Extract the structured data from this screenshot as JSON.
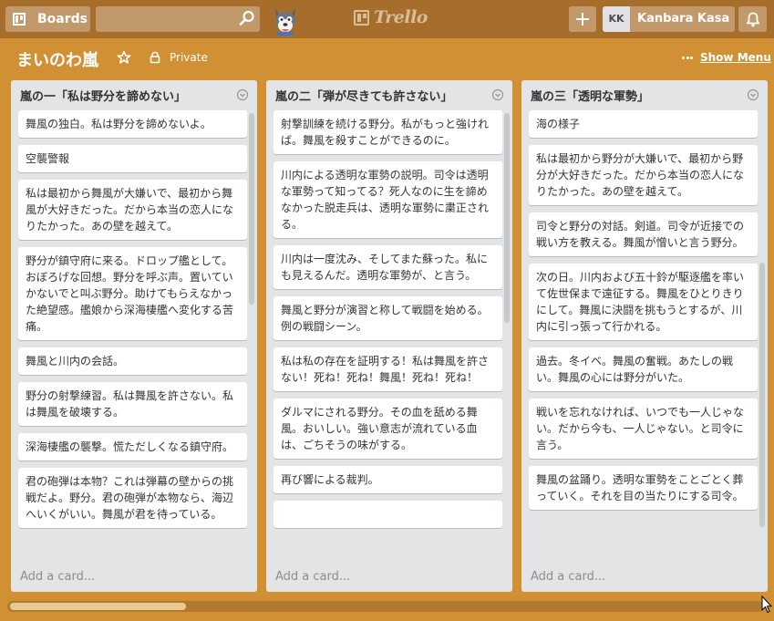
{
  "header": {
    "boards_label": "Boards",
    "search": {
      "value": "",
      "placeholder": ""
    },
    "logo_text": "Trello",
    "user": {
      "initials": "KK",
      "name": "Kanbara Kasa"
    }
  },
  "board": {
    "title": "まいのわ嵐",
    "visibility": "Private",
    "show_menu": "Show Menu"
  },
  "lists": [
    {
      "title": "嵐の一「私は野分を諦めない」",
      "cards": [
        "舞風の独白。私は野分を諦めないよ。",
        "空襲警報",
        "私は最初から舞風が大嫌いで、最初から舞風が大好きだった。だから本当の恋人になりたかった。あの壁を越えて。",
        "野分が鎮守府に来る。ドロップ艦として。おぼろげな回想。野分を呼ぶ声。置いていかないでと叫ぶ野分。助けてもらえなかった絶望感。艦娘から深海棲艦へ変化する苦痛。",
        "舞風と川内の会話。",
        "野分の射撃練習。私は舞風を許さない。私は舞風を破壊する。",
        "深海棲艦の襲撃。慌ただしくなる鎮守府。",
        "君の砲弾は本物？これは弾幕の壁からの挑戦だよ。野分。君の砲弾が本物なら、海辺へいくがいい。舞風が君を待っている。"
      ],
      "add_card": "Add a card..."
    },
    {
      "title": "嵐の二「弾が尽きても許さない」",
      "cards": [
        "射撃訓練を続ける野分。私がもっと強ければ。舞風を殺すことができるのに。",
        "川内による透明な軍勢の説明。司令は透明な軍勢って知ってる？死人なのに生を諦めなかった脱走兵は、透明な軍勢に粛正される。",
        "川内は一度沈み、そしてまた蘇った。私にも見えるんだ。透明な軍勢が、と言う。",
        "舞風と野分が演習と称して戦闘を始める。例の戦闘シーン。",
        "私は私の存在を証明する！私は舞風を許さない！死ね！死ね！舞風！死ね！死ね！",
        "ダルマにされる野分。その血を舐める舞風。おいしい。強い意志が流れている血は、ごちそうの味がする。",
        "再び響による裁判。",
        ""
      ],
      "add_card": "Add a card..."
    },
    {
      "title": "嵐の三「透明な軍勢」",
      "cards": [
        "海の様子",
        "私は最初から野分が大嫌いで、最初から野分が大好きだった。だから本当の恋人になりたかった。あの壁を越えて。",
        "司令と野分の対話。剣道。司令が近接での戦い方を教える。舞風が憎いと言う野分。",
        "次の日。川内および五十鈴が駆逐艦を率いて佐世保まで遠征する。舞風をひとりきりにして。舞風に決闘を挑もうとするが、川内に引っ張って行かれる。",
        "過去。冬イベ。舞風の奮戦。あたしの戦い。舞風の心には野分がいた。",
        "戦いを忘れなければ、いつでも一人じゃない。だから今も、一人じゃない。と司令に言う。",
        "舞風の盆踊り。透明な軍勢をことごとく葬っていく。それを目の当たりにする司令。"
      ],
      "add_card": "Add a card..."
    }
  ],
  "colors": {
    "board_bg": "#d29034",
    "header_bg": "#a76d2a",
    "list_bg": "#e2e4e6",
    "card_bg": "#ffffff"
  }
}
